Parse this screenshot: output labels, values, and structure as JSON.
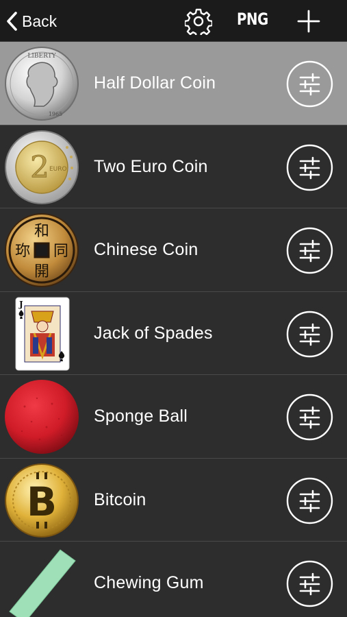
{
  "navbar": {
    "back_label": "Back",
    "format_label": "PNG",
    "icons": {
      "back": "chevron-left-icon",
      "settings": "gear-icon",
      "add": "plus-icon"
    }
  },
  "items": [
    {
      "label": "Half Dollar Coin",
      "thumb": "half-dollar-coin-image",
      "selected": true
    },
    {
      "label": "Two Euro Coin",
      "thumb": "two-euro-coin-image",
      "selected": false
    },
    {
      "label": "Chinese Coin",
      "thumb": "chinese-coin-image",
      "selected": false
    },
    {
      "label": "Jack of Spades",
      "thumb": "jack-of-spades-card-image",
      "selected": false
    },
    {
      "label": "Sponge Ball",
      "thumb": "sponge-ball-image",
      "selected": false
    },
    {
      "label": "Bitcoin",
      "thumb": "bitcoin-coin-image",
      "selected": false
    },
    {
      "label": "Chewing Gum",
      "thumb": "chewing-gum-image",
      "selected": false
    }
  ],
  "coin_text": {
    "half_dollar_top": "LIBERTY",
    "half_dollar_year": "1965",
    "euro_value": "2",
    "euro_word": "EURO",
    "chinese_chars": [
      "和",
      "同",
      "開",
      "珎"
    ],
    "card_rank": "J",
    "bitcoin_symbol": "B"
  },
  "colors": {
    "navbar_bg": "#1b1b1b",
    "row_bg": "#2d2d2d",
    "row_selected_bg": "#9a9a9a",
    "divider": "#4a4a4a",
    "text": "#ffffff"
  }
}
